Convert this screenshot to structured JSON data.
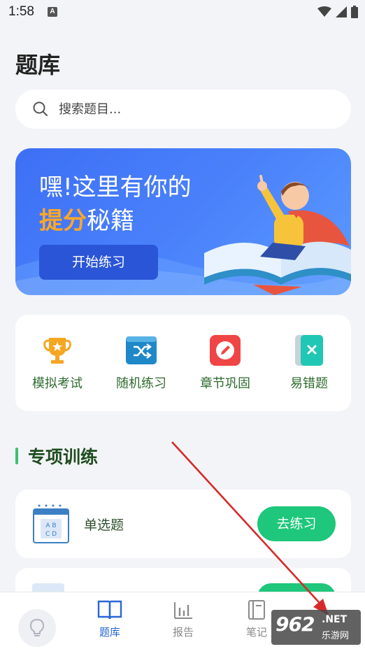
{
  "status": {
    "time": "1:58",
    "notif_letter": "A"
  },
  "page": {
    "title": "题库"
  },
  "search": {
    "placeholder": "搜索题目..."
  },
  "banner": {
    "line1": "嘿!这里有你的",
    "line2_highlight": "提分",
    "line2_rest": "秘籍",
    "button": "开始练习"
  },
  "quick_actions": [
    {
      "label": "模拟考试",
      "icon": "trophy-icon",
      "color": "#f5a623"
    },
    {
      "label": "随机练习",
      "icon": "shuffle-icon",
      "color": "#1e88c8"
    },
    {
      "label": "章节巩固",
      "icon": "pencil-icon",
      "color": "#f04545"
    },
    {
      "label": "易错题",
      "icon": "error-book-icon",
      "color": "#1fc7b4"
    }
  ],
  "section": {
    "title": "专项训练"
  },
  "cards": [
    {
      "label": "单选题",
      "button": "去练习",
      "icon_letters": "A B C D"
    }
  ],
  "tabs": [
    {
      "label": "题库",
      "icon": "book-icon",
      "active": true
    },
    {
      "label": "报告",
      "icon": "chart-icon",
      "active": false
    },
    {
      "label": "笔记",
      "icon": "notebook-icon",
      "active": false
    }
  ],
  "watermark": {
    "number": "962",
    "net": ".NET",
    "sub": "乐游网"
  },
  "colors": {
    "accent_green": "#1ec77b",
    "accent_blue": "#2a66d8",
    "banner_blue": "#4b83fb",
    "highlight_orange": "#ffa726"
  }
}
